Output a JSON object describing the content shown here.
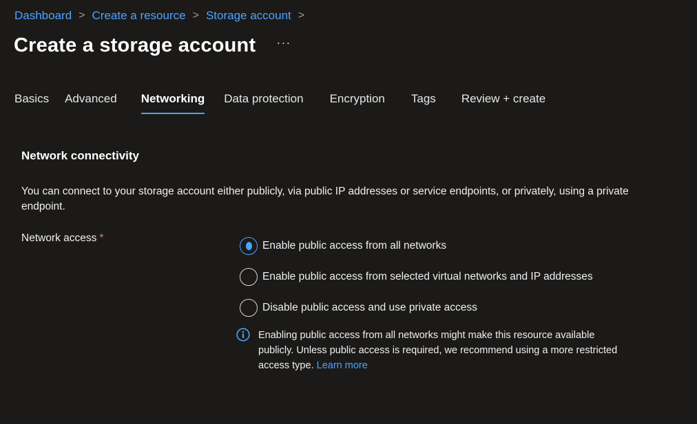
{
  "breadcrumb": {
    "items": [
      "Dashboard",
      "Create a resource",
      "Storage account"
    ],
    "separator": ">"
  },
  "header": {
    "title": "Create a storage account",
    "more_label": "···"
  },
  "tabs": [
    {
      "label": "Basics",
      "active": false
    },
    {
      "label": "Advanced",
      "active": false
    },
    {
      "label": "Networking",
      "active": true
    },
    {
      "label": "Data protection",
      "active": false
    },
    {
      "label": "Encryption",
      "active": false
    },
    {
      "label": "Tags",
      "active": false
    },
    {
      "label": "Review + create",
      "active": false
    }
  ],
  "section": {
    "heading": "Network connectivity",
    "description": "You can connect to your storage account either publicly, via public IP addresses or service endpoints, or privately, using a private endpoint."
  },
  "network_access": {
    "label": "Network access",
    "required_marker": "*",
    "options": [
      {
        "label": "Enable public access from all networks",
        "selected": true
      },
      {
        "label": "Enable public access from selected virtual networks and IP addresses",
        "selected": false
      },
      {
        "label": "Disable public access and use private access",
        "selected": false
      }
    ]
  },
  "info": {
    "icon": "info-icon",
    "text": "Enabling public access from all networks might make this resource available publicly. Unless public access is required, we recommend using a more restricted access type.",
    "link_label": "Learn more"
  },
  "colors": {
    "background": "#1b1a19",
    "accent": "#4da3ff",
    "required": "#f1707b"
  }
}
